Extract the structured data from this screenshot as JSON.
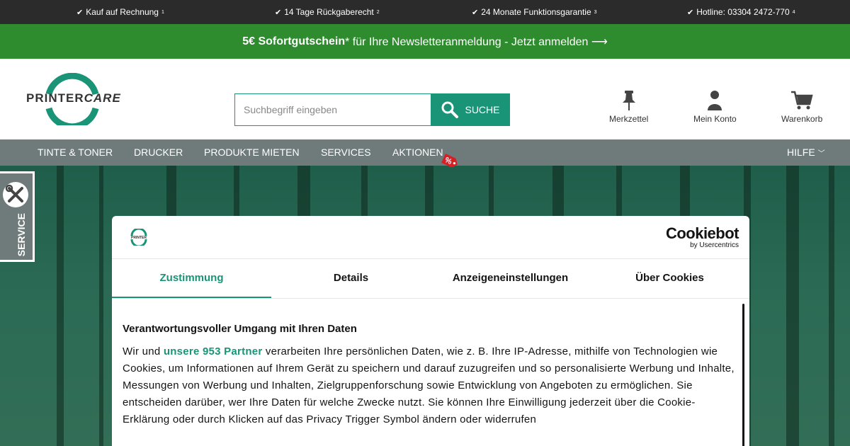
{
  "usp": [
    {
      "text": "Kauf auf Rechnung",
      "sup": "1"
    },
    {
      "text": "14 Tage Rückgaberecht",
      "sup": "2"
    },
    {
      "text": "24 Monate Funktionsgarantie",
      "sup": "3"
    },
    {
      "text": "Hotline: 03304 2472-770",
      "sup": "4"
    }
  ],
  "promo": {
    "bold": "5€ Sofortgutschein",
    "rest": "* für Ihre Newsletteranmeldung - Jetzt anmelden ⟶"
  },
  "logo": {
    "part1": "PRINTER",
    "part2": "CARE"
  },
  "search": {
    "placeholder": "Suchbegriff eingeben",
    "button": "SUCHE"
  },
  "header_icons": {
    "wishlist": "Merkzettel",
    "account": "Mein Konto",
    "cart": "Warenkorb"
  },
  "nav": {
    "items": [
      "TINTE & TONER",
      "DRUCKER",
      "PRODUKTE MIETEN",
      "SERVICES",
      "AKTIONEN"
    ],
    "help": "HILFE",
    "sale_symbol": "%"
  },
  "service_tab": {
    "label": "SERVICE"
  },
  "cookie": {
    "brand": "Cookiebot",
    "brand_by": "by Usercentrics",
    "tabs": [
      "Zustimmung",
      "Details",
      "Anzeigeneinstellungen",
      "Über Cookies"
    ],
    "title": "Verantwortungsvoller Umgang mit Ihren Daten",
    "text_before": "Wir und ",
    "partner_link": "unsere 953 Partner",
    "text_after": " verarbeiten Ihre persönlichen Daten, wie z. B. Ihre IP-Adresse, mithilfe von Technologien wie Cookies, um Informationen auf Ihrem Gerät zu speichern und darauf zuzugreifen und so personalisierte Werbung und Inhalte, Messungen von Werbung und Inhalten, Zielgruppenforschung sowie Entwicklung von Angeboten zu ermöglichen. Sie entscheiden darüber, wer Ihre Daten für welche Zwecke nutzt. Sie können Ihre Einwilligung jederzeit über die Cookie-Erklärung oder durch Klicken auf das Privacy Trigger Symbol ändern oder widerrufen"
  },
  "colors": {
    "brand_green": "#1a9477",
    "promo_green": "#2e8b2e",
    "nav_gray": "#6e7b7a",
    "top_bar": "#2b2b2b"
  }
}
